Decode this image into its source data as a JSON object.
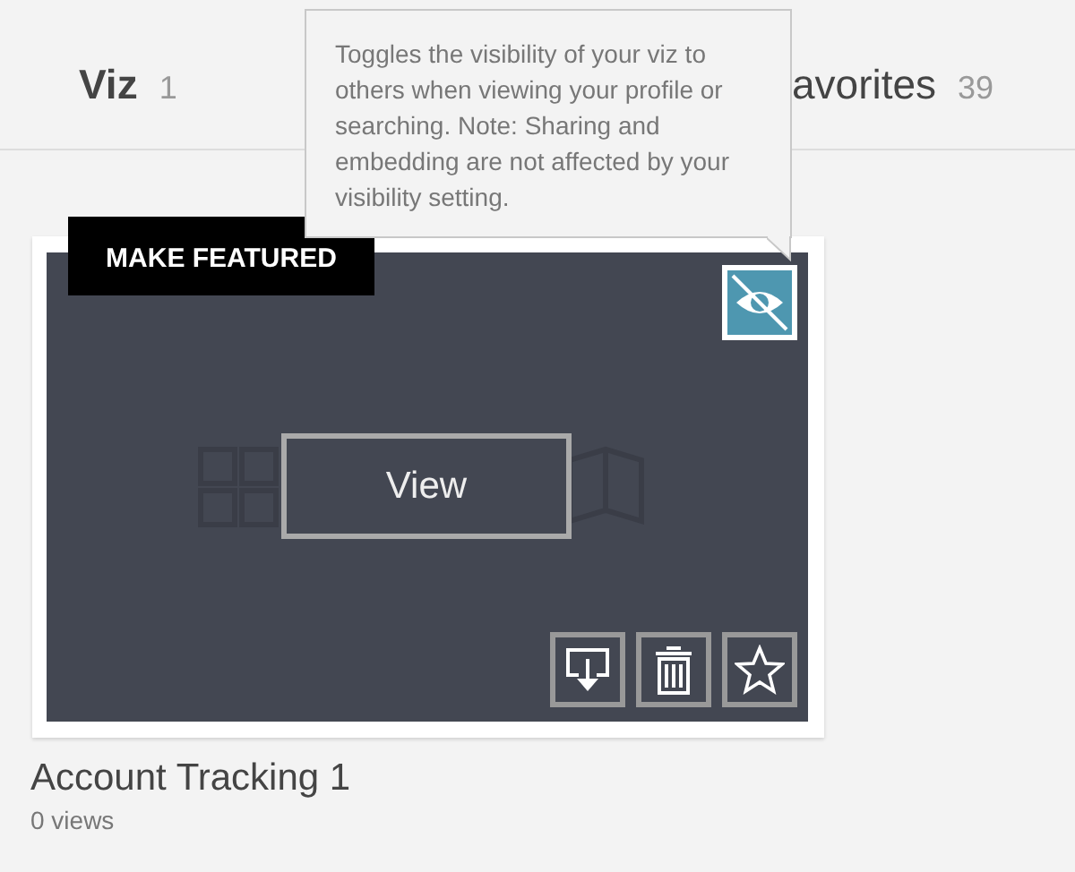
{
  "tabs": [
    {
      "label": "Viz",
      "count": "1",
      "selected": true
    },
    {
      "label": "avorites",
      "count": "39",
      "selected": false
    }
  ],
  "tooltip": {
    "text": "Toggles the visibility of your viz to others when viewing your profile or searching. Note: Sharing and embedding are not affected by your visibility setting."
  },
  "viz_card": {
    "featured_label": "MAKE FEATURED",
    "visible": false,
    "view_label": "View",
    "title": "Account Tracking 1",
    "views": "0 views"
  }
}
